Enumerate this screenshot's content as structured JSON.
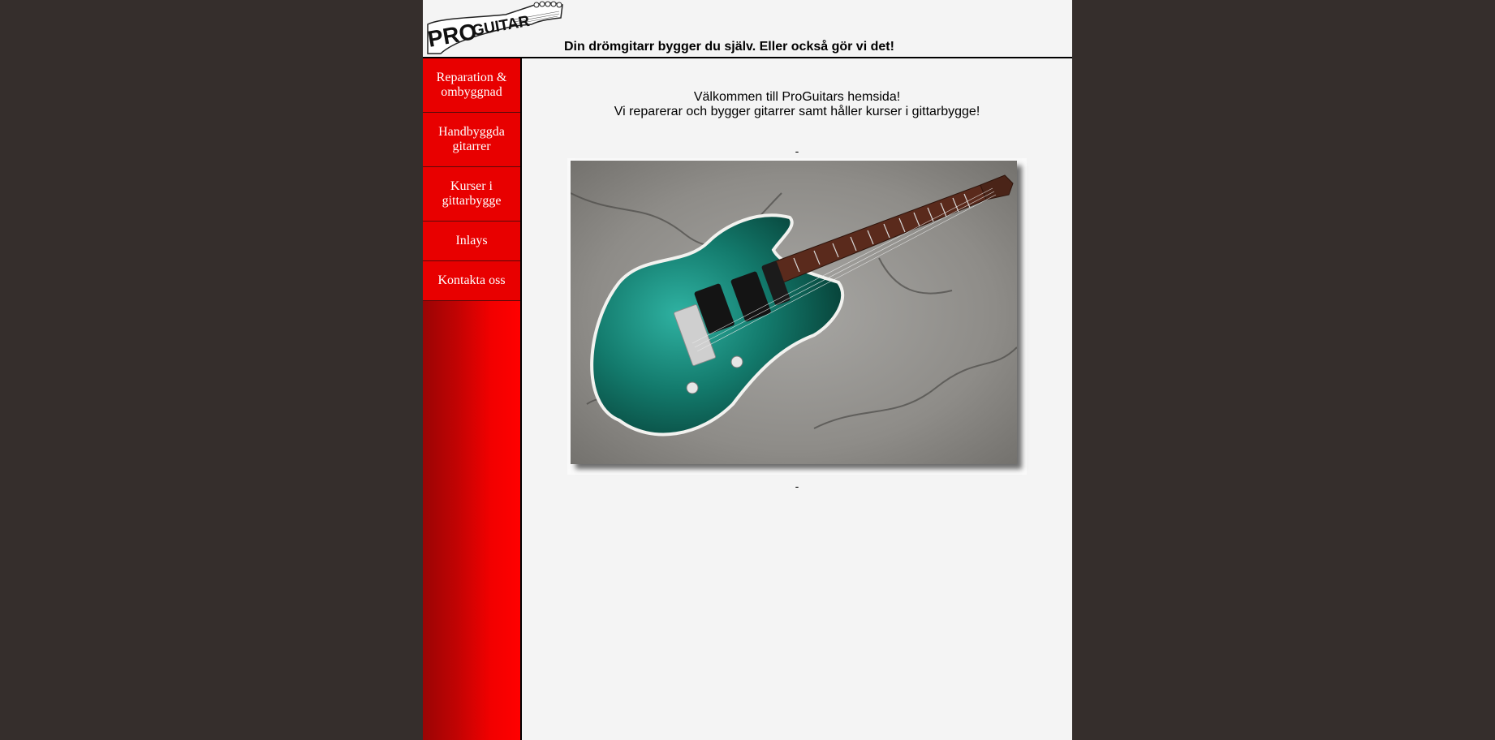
{
  "header": {
    "logo_text_pro": "PRO",
    "logo_text_guitar": "GUITAR",
    "tagline": "Din drömgitarr bygger du själv. Eller också gör vi det!"
  },
  "nav": {
    "items": [
      {
        "label_line1": "Reparation &",
        "label_line2": "ombyggnad"
      },
      {
        "label_line1": "Handbyggda",
        "label_line2": "gitarrer"
      },
      {
        "label_line1": "Kurser i",
        "label_line2": "gittarbygge"
      },
      {
        "label_line1": "Inlays",
        "label_line2": ""
      },
      {
        "label_line1": "Kontakta oss",
        "label_line2": ""
      }
    ]
  },
  "main": {
    "welcome_line1": "Välkommen till ProGuitars hemsida!",
    "welcome_line2": "Vi reparerar och bygger gitarrer samt håller kurser i gittarbygge!",
    "separator_top": "-",
    "separator_bottom": "-",
    "photo_icon": "guitar-photo"
  },
  "colors": {
    "background": "#352e2c",
    "page": "#f4f4f4",
    "sidebar_red": "#ff0000",
    "sidebar_dark": "#9a0505"
  }
}
